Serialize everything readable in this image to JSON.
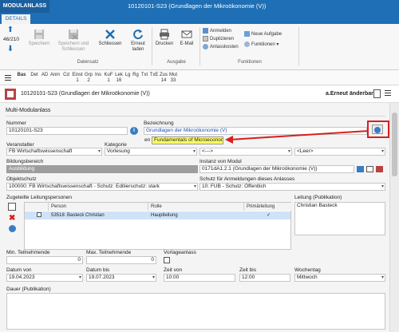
{
  "app_button": "MODULANLASS",
  "window_title": "10120101-S23 (Grundlagen der Mikroökonomie (V))",
  "ribbon_tab": "DETAILS",
  "record_counter": "46/210",
  "ribbon": {
    "speichern": "Speichern",
    "speichern_schliessen": "Speichern und Schliessen",
    "schliessen": "Schliessen",
    "erneut_laden": "Erneut laden",
    "drucken": "Drucken",
    "email": "E-Mail",
    "anmelden": "Anmelden",
    "duplizieren": "Duplizieren",
    "anlasskosten": "Anlasskosten",
    "neue_aufgabe": "Neue Aufgabe",
    "funktionen": "Funktionen ▾",
    "group_datensatz": "Datensatz",
    "group_ausgabe": "Ausgabe",
    "group_funktionen": "Funktionen"
  },
  "nav_tabs": [
    {
      "label": "Bas",
      "count": ""
    },
    {
      "label": "Det",
      "count": ""
    },
    {
      "label": "AD",
      "count": ""
    },
    {
      "label": "Anm",
      "count": ""
    },
    {
      "label": "Cd",
      "count": ""
    },
    {
      "label": "Einst",
      "count": "1"
    },
    {
      "label": "Grp",
      "count": "2"
    },
    {
      "label": "Ins",
      "count": ""
    },
    {
      "label": "KuF",
      "count": "1"
    },
    {
      "label": "Lek",
      "count": "16"
    },
    {
      "label": "Lg",
      "count": ""
    },
    {
      "label": "Rg",
      "count": ""
    },
    {
      "label": "Txt",
      "count": ""
    },
    {
      "label": "TxE",
      "count": ""
    },
    {
      "label": "Zus",
      "count": "14"
    },
    {
      "label": "Mut",
      "count": "33"
    }
  ],
  "record_header": {
    "title": "10120101-S23 (Grundlagen der Mikroökonomie (V))",
    "status": "a.Erneut änderbar"
  },
  "section_title": "Multi-Modulanlass",
  "fields": {
    "nummer_label": "Nummer",
    "nummer_value": "10120101-S23",
    "bezeichnung_label": "Bezeichnung",
    "bezeichnung_value": "Grundlagen der Mikroökonomie (V)",
    "lang_code": "en",
    "translation_value": "Fundamentals of Microeconomics (V)",
    "veranstalter_label": "Veranstalter",
    "veranstalter_value": "FB Wirtschaftswissenschaft",
    "kategorie_label": "Kategorie",
    "kategorie_value": "Vorlesung",
    "third_value": "<--->",
    "leer_value": "<Leer>",
    "bildungsbereich_label": "Bildungsbereich",
    "bildungsbereich_value": "Ausbildung",
    "instanz_label": "Instanz von Modul",
    "instanz_value": "0171dA1.2.1 (Grundlagen der Mikroökonomie (V))",
    "objektschutz_label": "Objektschutz",
    "objektschutz_value": "100000: FB Wirtschaftswissenschaft - Schutz: Editierschutz: stark",
    "schutz_anm_label": "Schutz für Anmeldungen dieses Anlasses",
    "schutz_anm_value": "10: FUB - Schutz: Öffentlich",
    "leitung_label": "Zugeteilte Leitungspersonen",
    "leitung_pub_label": "Leitung (Publikation)",
    "leitung_pub_value": "Christian Basteck",
    "min_tn_label": "Min. Teilnehmende",
    "min_tn_value": "0",
    "max_tn_label": "Max. Teilnehmende",
    "max_tn_value": "0",
    "vorlage_label": "Vorlageanlass",
    "datum_von_label": "Datum von",
    "datum_von_value": "19.04.2023",
    "datum_bis_label": "Datum bis",
    "datum_bis_value": "19.07.2023",
    "zeit_von_label": "Zeit von",
    "zeit_von_value": "10:00",
    "zeit_bis_label": "Zeit bis",
    "zeit_bis_value": "12:00",
    "wochentag_label": "Wochentag",
    "wochentag_value": "Mittwoch",
    "dauer_label": "Dauer (Publikation)"
  },
  "grid": {
    "headers": [
      "Person",
      "Rolle",
      "Primärleitung"
    ],
    "rows": [
      {
        "person": "53518: Basteck Christian",
        "rolle": "Hauptleitung",
        "primaer": "✓"
      }
    ]
  },
  "colors": {
    "brand": "#1e6fb5",
    "highlight_box": "#d81e1e",
    "tooltip_bg": "#ffff66"
  }
}
